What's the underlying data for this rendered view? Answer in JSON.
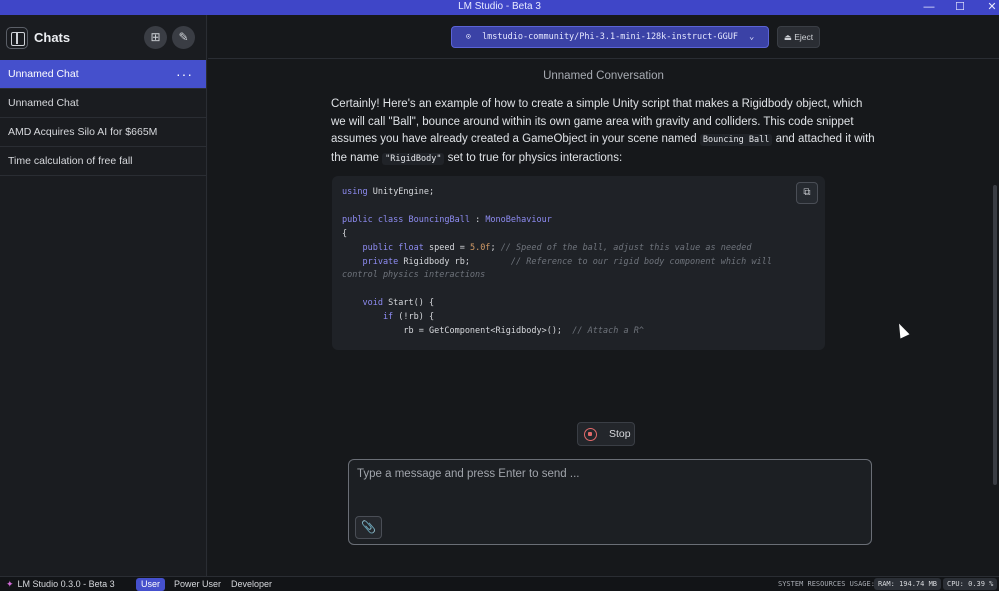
{
  "window": {
    "title": "LM Studio - Beta 3",
    "controls": [
      "—",
      "☐",
      "✕"
    ]
  },
  "sidebar": {
    "title": "Chats",
    "chats": [
      {
        "label": "Unnamed Chat",
        "active": true
      },
      {
        "label": "Unnamed Chat",
        "active": false
      },
      {
        "label": "AMD Acquires Silo AI for $665M",
        "active": false
      },
      {
        "label": "Time calculation of free fall",
        "active": false
      }
    ],
    "more_label": "···",
    "new_folder_icon": "⊞",
    "new_chat_icon": "✎"
  },
  "topbar": {
    "model": "lmstudio-community/Phi-3.1-mini-128k-instruct-GGUF",
    "model_icon": "⊙",
    "chevron": "⌄",
    "eject_label": "Eject",
    "eject_icon": "⏏"
  },
  "conversation": {
    "title": "Unnamed Conversation",
    "message_parts": {
      "p1": "Certainly! Here's an example of how to create a simple Unity script that makes a Rigidbody object, which we will call \"Ball\", bounce around within its own game area with gravity and colliders. This code snippet assumes you have already created a GameObject in your scene named ",
      "code1": "Bouncing Ball",
      "p2": " and attached it with the name ",
      "code2": "\"RigidBody\"",
      "p3": " set to true for physics interactions:"
    },
    "code": {
      "line1a": "using ",
      "line1b": "UnityEngine;",
      "line2a": "public class ",
      "line2b": "BouncingBall",
      "line2c": " : ",
      "line2d": "MonoBehaviour",
      "line3": "{",
      "line4a": "    public float ",
      "line4b": "speed = ",
      "line4c": "5.0f",
      "line4d": "; ",
      "line4e": "// Speed of the ball, adjust this value as needed",
      "line5a": "    private ",
      "line5b": "Rigidbody rb;        ",
      "line5c": "// Reference to our rigid body component which will",
      "line6": "control physics interactions",
      "line7a": "    void ",
      "line7b": "Start() {",
      "line8a": "        if ",
      "line8b": "(!rb) {",
      "line9a": "            rb = GetComponent<Rigidbody>();  ",
      "line9b": "// Attach a R^"
    },
    "copy_icon": "⧉",
    "stop_label": "Stop"
  },
  "composer": {
    "placeholder": "Type a message and press Enter to send ...",
    "attach_icon": "📎"
  },
  "statusbar": {
    "app_logo": "✦",
    "app_version": "LM Studio 0.3.0 - Beta 3",
    "modes": [
      "User",
      "Power User",
      "Developer"
    ],
    "resources_label": "SYSTEM RESOURCES USAGE:",
    "ram": "RAM: 194.74 MB",
    "cpu": "CPU: 0.39 %"
  },
  "colors": {
    "accent": "#4550cc",
    "titlebar": "#3f46c8",
    "background": "#16181b"
  }
}
